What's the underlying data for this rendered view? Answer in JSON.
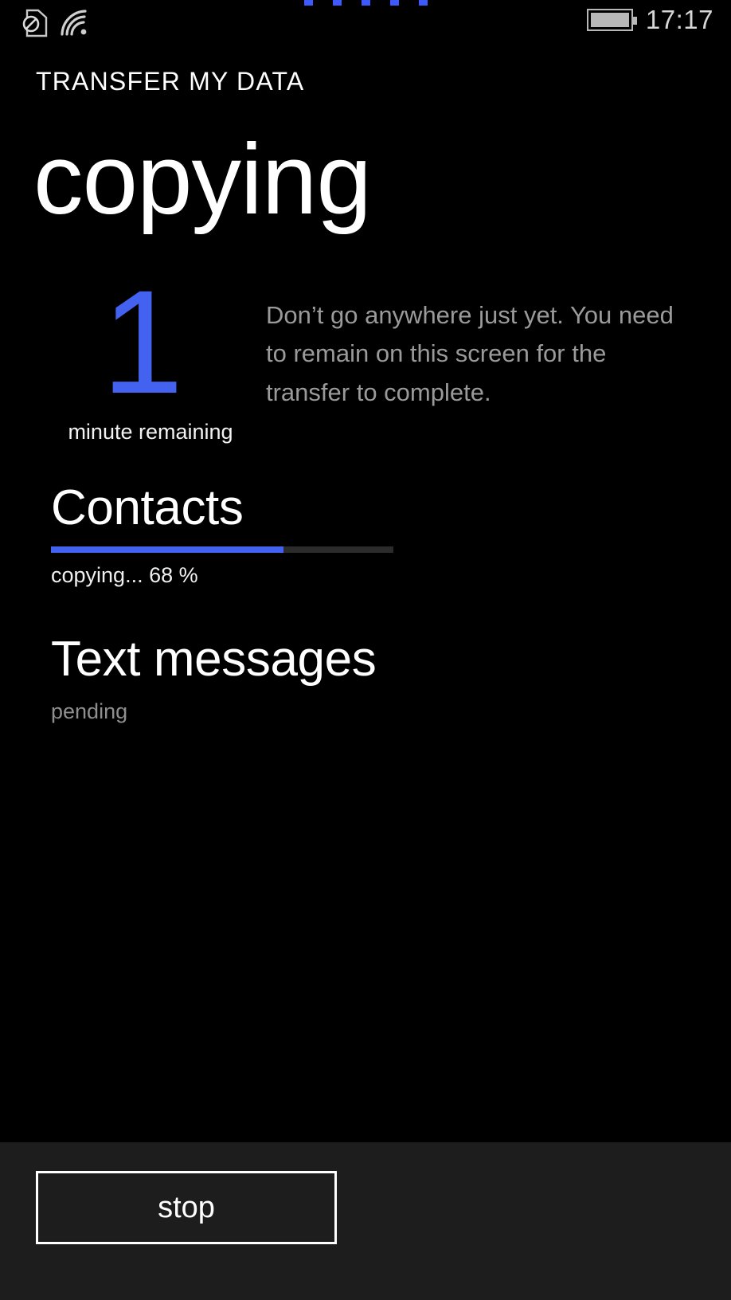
{
  "status_bar": {
    "sim_icon": "no-sim-icon",
    "wifi_icon": "wifi-icon",
    "battery_icon": "battery-full-icon",
    "time": "17:17",
    "progress_dots": 5,
    "dot_color": "#3d5afe"
  },
  "header": {
    "app_title": "TRANSFER MY DATA",
    "page_title": "copying"
  },
  "eta": {
    "number": "1",
    "label": "minute remaining",
    "note": "Don’t go anywhere just yet. You need to remain on this screen for the transfer to complete.",
    "accent_color": "#4462f0"
  },
  "tasks": [
    {
      "name": "Contacts",
      "status": "copying... 68 %",
      "progress": 68,
      "has_progress_bar": true,
      "muted": false
    },
    {
      "name": "Text messages",
      "status": "pending",
      "progress": 0,
      "has_progress_bar": false,
      "muted": true
    }
  ],
  "appbar": {
    "stop_label": "stop"
  }
}
